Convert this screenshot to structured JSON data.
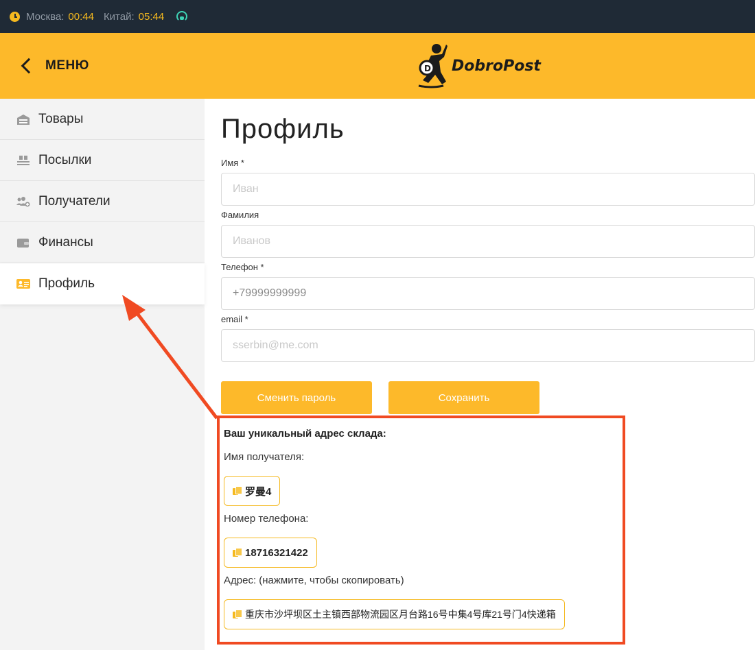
{
  "status_bar": {
    "moscow_label": "Москва:",
    "moscow_time": "00:44",
    "china_label": "Китай:",
    "china_time": "05:44"
  },
  "header": {
    "menu_label": "МЕНЮ",
    "logo_text": "DobroPost"
  },
  "sidebar": {
    "items": [
      {
        "label": "Товары",
        "icon": "warehouse-icon"
      },
      {
        "label": "Посылки",
        "icon": "parcels-icon"
      },
      {
        "label": "Получатели",
        "icon": "recipients-icon"
      },
      {
        "label": "Финансы",
        "icon": "wallet-icon"
      },
      {
        "label": "Профиль",
        "icon": "profile-card-icon",
        "active": true
      }
    ]
  },
  "profile": {
    "title": "Профиль",
    "first_name": {
      "label": "Имя *",
      "placeholder": "Иван"
    },
    "last_name": {
      "label": "Фамилия",
      "placeholder": "Иванов"
    },
    "phone": {
      "label": "Телефон *",
      "value": "+79999999999"
    },
    "email": {
      "label": "email *",
      "placeholder": "sserbin@me.com"
    },
    "change_password_label": "Сменить пароль",
    "save_label": "Сохранить"
  },
  "warehouse": {
    "title": "Ваш уникальный адрес склада:",
    "recipient_label": "Имя получателя:",
    "recipient_value": "罗曼4",
    "phone_label": "Номер телефона:",
    "phone_value": "18716321422",
    "address_label": "Адрес: (нажмите, чтобы скопировать)",
    "address_value": "重庆市沙坪坝区土主镇西部物流园区月台路16号中集4号库21号门4快递箱"
  },
  "colors": {
    "accent": "#fdb92a",
    "dark": "#1f2a36",
    "highlight": "#f04a22",
    "support": "#3fd3b6"
  }
}
